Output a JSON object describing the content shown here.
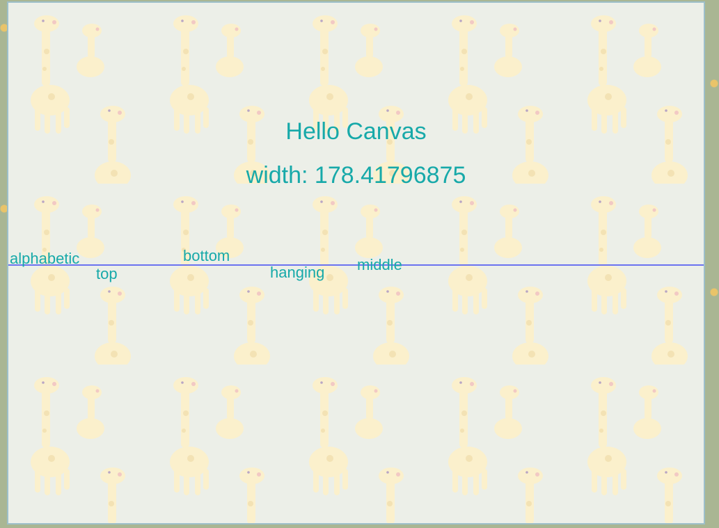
{
  "canvas": {
    "title": "Hello Canvas",
    "width_text": "width: 178.41796875",
    "baseline_labels": {
      "alphabetic": "alphabetic",
      "top": "top",
      "bottom": "bottom",
      "hanging": "hanging",
      "middle": "middle"
    },
    "colors": {
      "text": "#17a9a9",
      "rule": "#6b73f0",
      "background": "#ecefe8",
      "frame_border": "#9dbfc9"
    },
    "background_icon": "giraffe-pattern"
  }
}
